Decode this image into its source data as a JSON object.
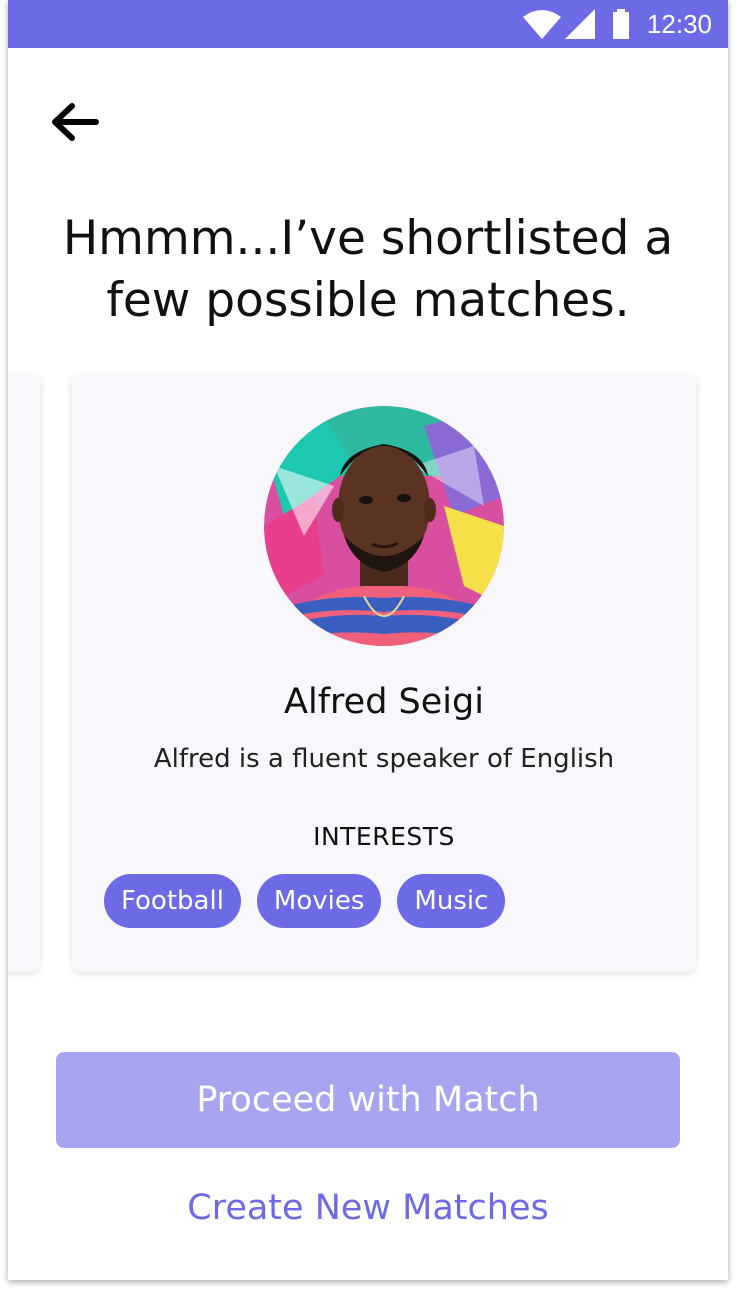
{
  "status_bar": {
    "time": "12:30",
    "background_color": "#6d6ae6",
    "icons": [
      "wifi-icon",
      "cell-signal-icon",
      "battery-icon"
    ]
  },
  "header": {
    "back_icon": "arrow-left-icon"
  },
  "headline": {
    "line1": "Hmmm...I’ve shortlisted a",
    "line2": "few possible matches."
  },
  "match_card": {
    "avatar": "profile-photo",
    "name": "Alfred Seigi",
    "description": "Alfred is a fluent speaker of English",
    "interests_heading": "INTERESTS",
    "interests": [
      "Football",
      "Movies",
      "Music"
    ]
  },
  "actions": {
    "proceed_label": "Proceed with Match",
    "create_label": "Create New Matches"
  },
  "colors": {
    "accent": "#6d6ae6",
    "accent_disabled": "#a7a5ef",
    "card_background": "#f7f7fc"
  }
}
